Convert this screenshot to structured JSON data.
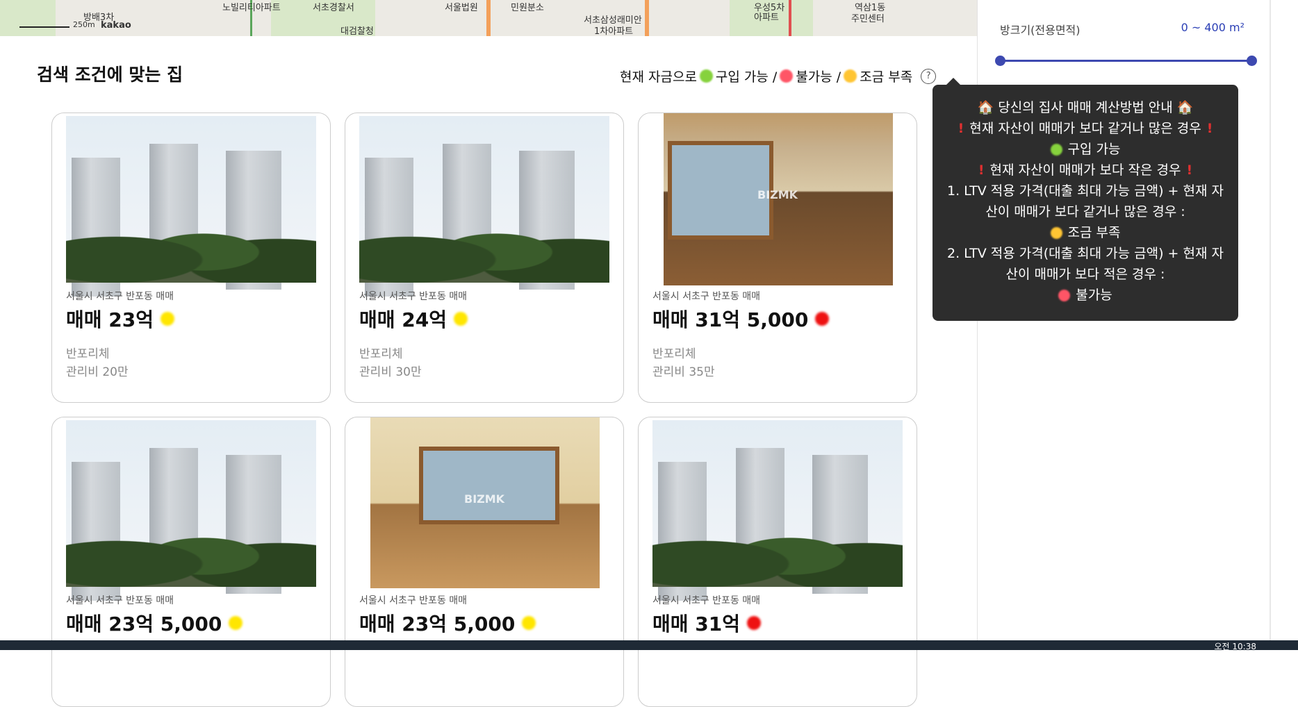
{
  "map": {
    "labels": [
      "방배3차",
      "노빌리티아파트",
      "서초경찰서",
      "서울법원",
      "민원분소",
      "서초삼성래미안",
      "우성5차",
      "역삼1동",
      "대검찰청",
      "주민센터",
      "1차아파트",
      "아파트",
      "kakao",
      "250m"
    ]
  },
  "main": {
    "title": "검색 조건에 맞는 집",
    "legend": {
      "prefix": "현재 자금으로",
      "ok": "구입 가능 /",
      "no": "불가능 /",
      "short": "조금 부족"
    },
    "help_icon": "question-circle-icon"
  },
  "listings": [
    {
      "area": "서울시 서초구 반포동 매매",
      "price": "매매 23억",
      "status": "short",
      "building": "반포리체",
      "fee": "관리비 20만",
      "photo": "apartment-exterior"
    },
    {
      "area": "서울시 서초구 반포동 매매",
      "price": "매매 24억",
      "status": "short",
      "building": "반포리체",
      "fee": "관리비 30만",
      "photo": "apartment-exterior"
    },
    {
      "area": "서울시 서초구 반포동 매매",
      "price": "매매 31억 5,000",
      "status": "no",
      "building": "반포리체",
      "fee": "관리비 35만",
      "photo": "interior-room"
    },
    {
      "area": "서울시 서초구 반포동 매매",
      "price": "매매 23억 5,000",
      "status": "short",
      "photo": "apartment-exterior"
    },
    {
      "area": "서울시 서초구 반포동 매매",
      "price": "매매 23억 5,000",
      "status": "short",
      "photo": "interior-room"
    },
    {
      "area": "서울시 서초구 반포동 매매",
      "price": "매매 31억",
      "status": "no",
      "photo": "apartment-exterior"
    }
  ],
  "sidebar": {
    "size_label": "방크기(전용면적)",
    "size_value": "0 ~ 400 m²",
    "slider_min_fraction": 0,
    "slider_max_fraction": 1
  },
  "tooltip": {
    "title": "🏠 당신의 집사 매매 계산방법 안내 🏠",
    "case1": "현재 자산이 매매가 보다 같거나 많은 경우",
    "ok": "구입 가능",
    "case2": "현재 자산이 매매가 보다 작은 경우",
    "line1a": "1. LTV 적용 가격(대출 최대 가능 금액) + 현재 자",
    "line1b": "산이 매매가 보다 같거나 많은 경우 :",
    "short": "조금 부족",
    "line2a": "2. LTV 적용 가격(대출 최대 가능 금액) + 현재 자",
    "line2b": "산이 매매가 보다 적은 경우 :",
    "no": "불가능"
  },
  "watermark": "BIZMK",
  "taskbar": {
    "clock": "오전 10:38"
  },
  "colors": {
    "ok": "#86d23d",
    "no": "#ff5566",
    "short": "#ffc533",
    "accent": "#3d49b0"
  }
}
